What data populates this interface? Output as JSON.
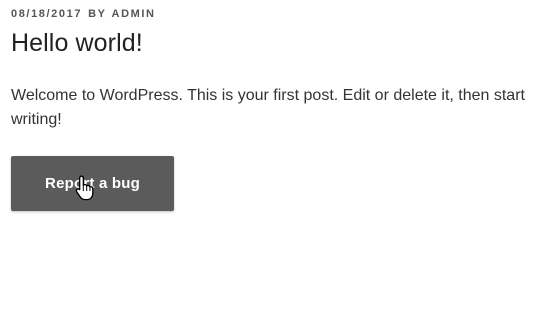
{
  "post": {
    "date": "08/18/2017",
    "by_label": "BY",
    "author": "ADMIN",
    "title": "Hello world!",
    "content": "Welcome to WordPress. This is your first post. Edit or delete it, then start writing!",
    "button_label": "Report a bug"
  },
  "colors": {
    "button_bg": "#5b5b5b",
    "button_text": "#ffffff",
    "text": "#333333",
    "meta": "#555555"
  },
  "cursor": {
    "icon": "hand-pointer-icon"
  }
}
